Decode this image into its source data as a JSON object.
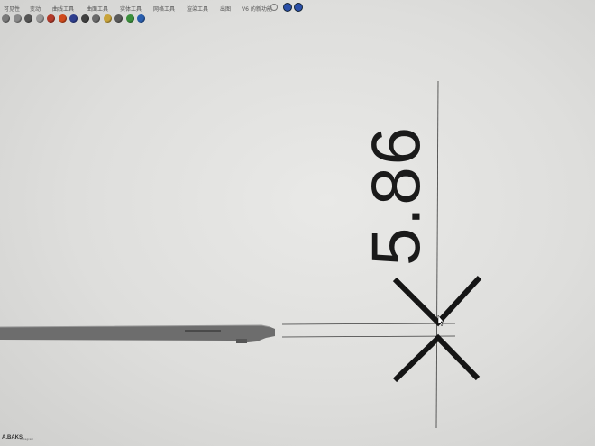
{
  "menubar": {
    "items": [
      "可见性",
      "变动",
      "曲线工具",
      "曲面工具",
      "实体工具",
      "网格工具",
      "渲染工具",
      "出图",
      "V6 的新功能"
    ]
  },
  "toolbar": {
    "icons": [
      {
        "name": "undo-icon",
        "color": "#7a7a7a"
      },
      {
        "name": "zoom-icon",
        "color": "#8a8a8a"
      },
      {
        "name": "orbit-icon",
        "color": "#555555"
      },
      {
        "name": "pan-icon",
        "color": "#9a9a9a"
      },
      {
        "name": "shade-icon",
        "color": "#b33a2a"
      },
      {
        "name": "render-icon",
        "color": "#d04a1c"
      },
      {
        "name": "material-icon",
        "color": "#2f3f8f"
      },
      {
        "name": "sphere-icon",
        "color": "#404040"
      },
      {
        "name": "light-icon",
        "color": "#6a6a6a"
      },
      {
        "name": "camera-icon",
        "color": "#c9a43b"
      },
      {
        "name": "print-icon",
        "color": "#5a5a5a"
      },
      {
        "name": "grid-icon",
        "color": "#3a8f3a"
      },
      {
        "name": "globe-icon",
        "color": "#2a5fae"
      }
    ]
  },
  "viewport": {
    "dimension_value": "5.86",
    "accent": "#1a1a1a",
    "part_color": "#6c6c6c"
  },
  "watermark": {
    "brand": "A.BAKS",
    "sub": "instagram"
  }
}
